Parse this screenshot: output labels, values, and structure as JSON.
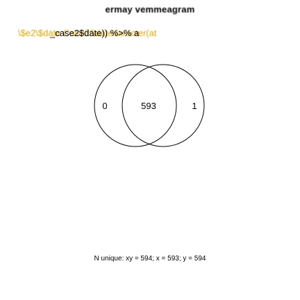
{
  "title": "ermay vemmeagram",
  "sublabel_ghost": "\\$e2\\$date Case2Sdatedaracter(at",
  "sublabel_main": "_case2$date)) %>% a",
  "venn": {
    "left_only": "0",
    "intersection": "593",
    "right_only": "1"
  },
  "footer": "N unique: xy = 594; x = 593; y = 594"
}
